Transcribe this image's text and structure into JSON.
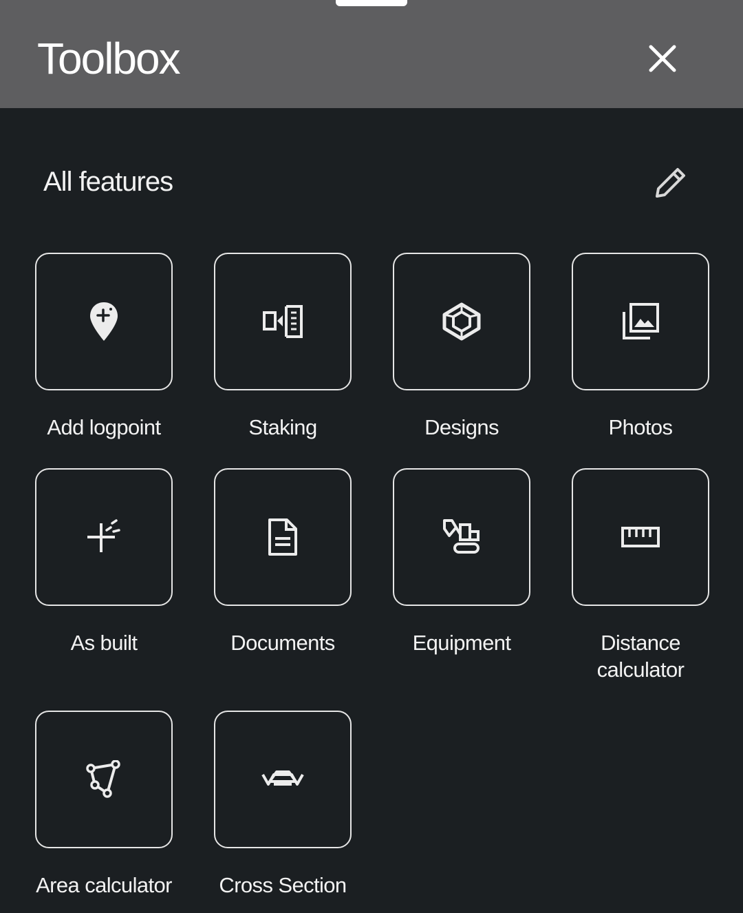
{
  "header": {
    "title": "Toolbox",
    "close_icon": "close-icon",
    "background": "#5e5e60"
  },
  "section": {
    "title": "All features",
    "edit_icon": "pencil-icon"
  },
  "features": [
    {
      "label": "Add logpoint",
      "icon": "map-pin-plus-icon"
    },
    {
      "label": "Staking",
      "icon": "staking-icon"
    },
    {
      "label": "Designs",
      "icon": "cube-icon"
    },
    {
      "label": "Photos",
      "icon": "photo-library-icon"
    },
    {
      "label": "As built",
      "icon": "sparkle-plus-icon"
    },
    {
      "label": "Documents",
      "icon": "document-icon"
    },
    {
      "label": "Equipment",
      "icon": "excavator-icon"
    },
    {
      "label": "Distance calculator",
      "icon": "ruler-icon"
    },
    {
      "label": "Area calculator",
      "icon": "polygon-icon"
    },
    {
      "label": "Cross Section",
      "icon": "cross-section-icon"
    }
  ],
  "colors": {
    "background": "#1b1f22",
    "tile_border": "#e6e6e6",
    "text": "#f2f2f2"
  }
}
